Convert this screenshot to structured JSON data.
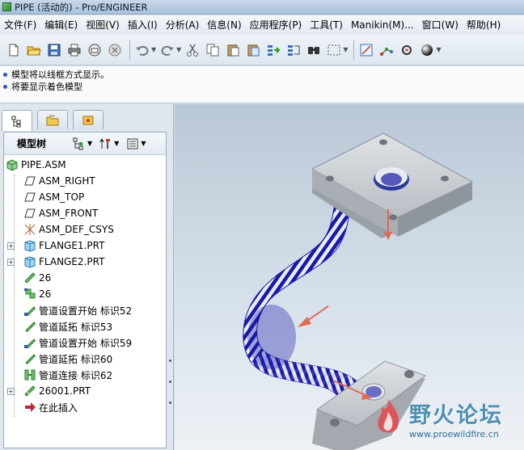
{
  "window": {
    "title": "PIPE (活动的) - Pro/ENGINEER"
  },
  "menubar": {
    "items": [
      "文件(F)",
      "编辑(E)",
      "视图(V)",
      "插入(I)",
      "分析(A)",
      "信息(N)",
      "应用程序(P)",
      "工具(T)",
      "Manikin(M)...",
      "窗口(W)",
      "帮助(H)"
    ]
  },
  "toolbar": {
    "icons": [
      "new-icon",
      "open-icon",
      "save-icon",
      "print-icon",
      "email-icon",
      "close-window-icon",
      "undo-icon",
      "redo-icon",
      "cut-icon",
      "copy-icon",
      "paste-icon",
      "paste-special-icon",
      "regenerate-icon",
      "regen-manager-icon",
      "find-icon",
      "select-box-icon",
      "datum-display-icon",
      "datum-axis-icon",
      "datum-point-icon",
      "shading-icon"
    ]
  },
  "messages": [
    "模型将以线框方式显示。",
    "将要显示着色模型"
  ],
  "navigator": {
    "tabs": [
      "model-tree-tab",
      "folder-browser-tab",
      "favorites-tab"
    ],
    "title": "模型树"
  },
  "tree": {
    "items": [
      {
        "label": "PIPE.ASM",
        "icon": "assembly-icon",
        "level": 0,
        "expand": ""
      },
      {
        "label": "ASM_RIGHT",
        "icon": "datum-plane-icon",
        "level": 1,
        "expand": ""
      },
      {
        "label": "ASM_TOP",
        "icon": "datum-plane-icon",
        "level": 1,
        "expand": ""
      },
      {
        "label": "ASM_FRONT",
        "icon": "datum-plane-icon",
        "level": 1,
        "expand": ""
      },
      {
        "label": "ASM_DEF_CSYS",
        "icon": "csys-icon",
        "level": 1,
        "expand": ""
      },
      {
        "label": "FLANGE1.PRT",
        "icon": "part-icon",
        "level": 1,
        "expand": "+"
      },
      {
        "label": "FLANGE2.PRT",
        "icon": "part-icon",
        "level": 1,
        "expand": "+"
      },
      {
        "label": "26",
        "icon": "pipe-segment-icon",
        "level": 1,
        "expand": ""
      },
      {
        "label": "26",
        "icon": "pipe-fitting-icon",
        "level": 1,
        "expand": ""
      },
      {
        "label": "管道设置开始 标识52",
        "icon": "pipe-start-icon",
        "level": 1,
        "expand": ""
      },
      {
        "label": "管道延拓 标识53",
        "icon": "pipe-extend-icon",
        "level": 1,
        "expand": ""
      },
      {
        "label": "管道设置开始 标识59",
        "icon": "pipe-start-icon",
        "level": 1,
        "expand": ""
      },
      {
        "label": "管道延拓 标识60",
        "icon": "pipe-extend-icon",
        "level": 1,
        "expand": ""
      },
      {
        "label": "管道连接 标识62",
        "icon": "pipe-connect-icon",
        "level": 1,
        "expand": ""
      },
      {
        "label": "26001.PRT",
        "icon": "pipe-part-icon",
        "level": 1,
        "expand": "+"
      },
      {
        "label": "在此插入",
        "icon": "insert-here-icon",
        "level": 1,
        "expand": ""
      }
    ]
  },
  "watermark": {
    "brand": "野火论坛",
    "url": "www.proewildfire.cn"
  },
  "colors": {
    "pipe": "#1a1aa8",
    "flange": "#c8cdd2",
    "arrow": "#e06a52",
    "accent": "#2a59b8"
  }
}
